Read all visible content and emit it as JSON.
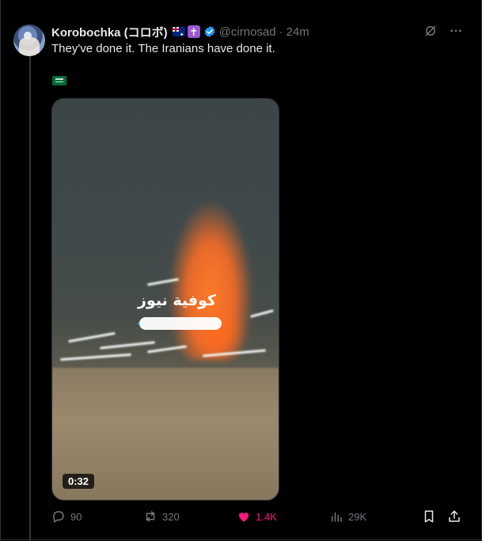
{
  "author": {
    "name": "Korobochka (コロボ)",
    "handle": "@cirnosad",
    "separator": "·",
    "time": "24m"
  },
  "tweet": {
    "text": "They've done it. The Iranians have done it."
  },
  "media": {
    "watermark": "كوفية نيوز",
    "duration": "0:32"
  },
  "stats": {
    "replies": "90",
    "reposts": "320",
    "likes": "1.4K",
    "views": "29K"
  },
  "colors": {
    "background": "#000000",
    "text": "#e7e9ea",
    "muted": "#71767b",
    "like_pink": "#f91880",
    "verified_blue": "#1d9bf0"
  }
}
